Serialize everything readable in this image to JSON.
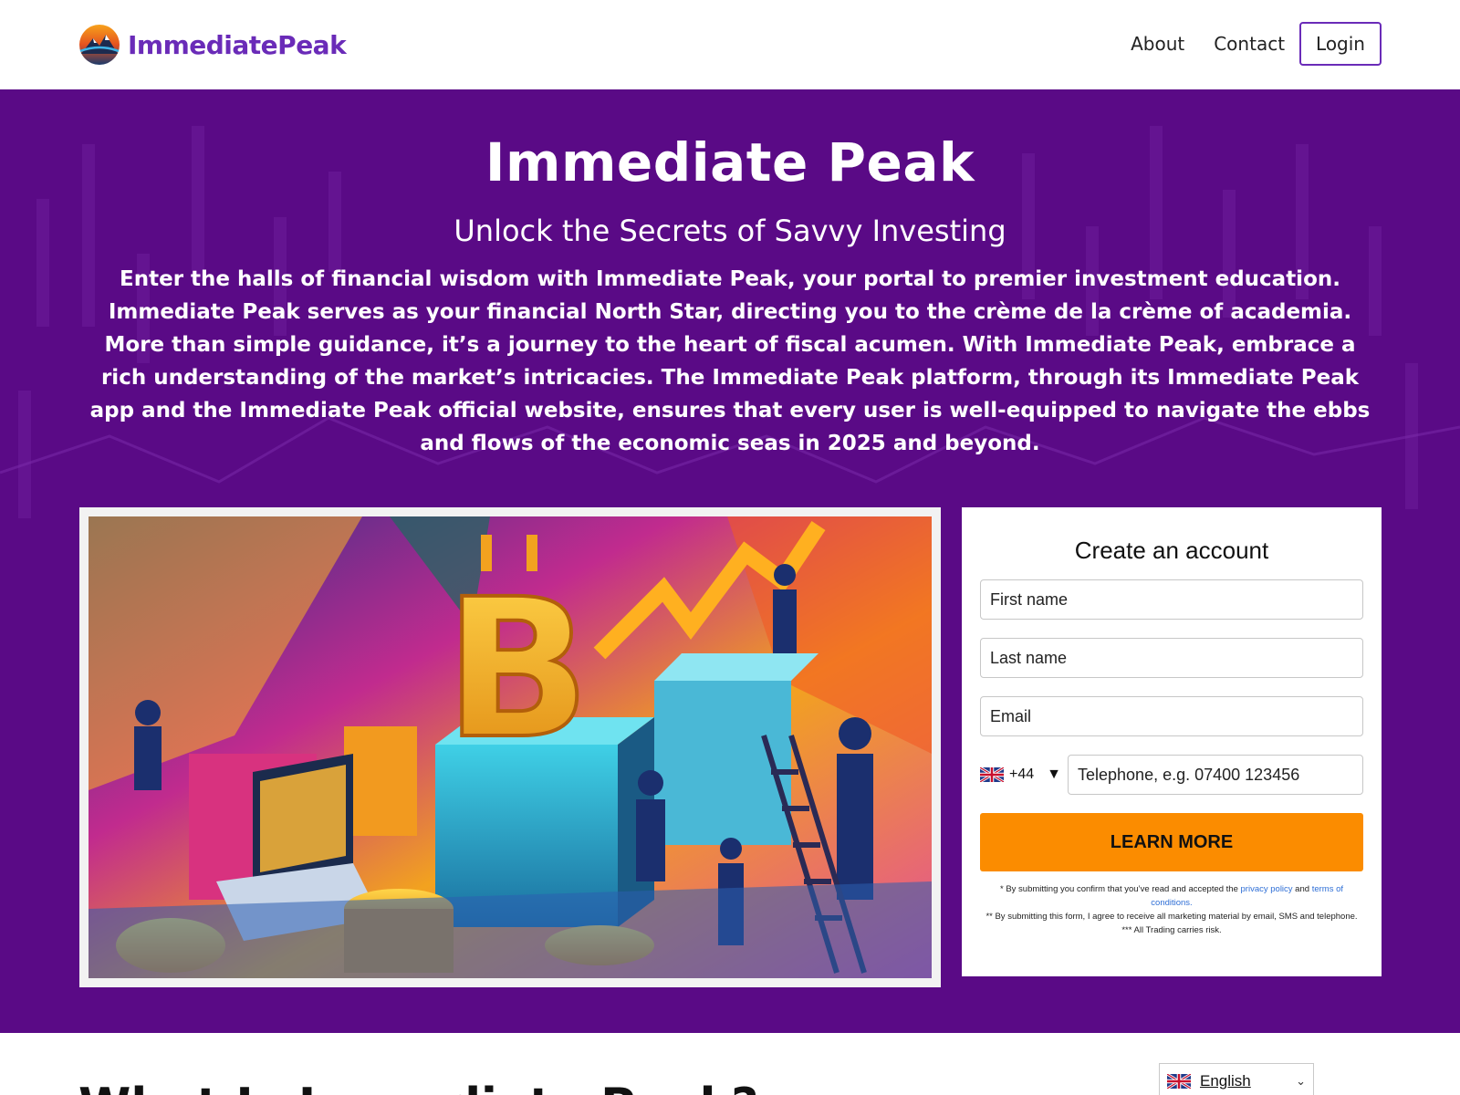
{
  "brand": {
    "name": "ImmediatePeak",
    "logo_icon": "mountain-sun-logo"
  },
  "nav": {
    "about": "About",
    "contact": "Contact",
    "login": "Login"
  },
  "hero": {
    "title": "Immediate Peak",
    "subtitle": "Unlock the Secrets of Savvy Investing",
    "paragraph": "Enter the halls of financial wisdom with Immediate Peak, your portal to premier investment education. Immediate Peak serves as your financial North Star, directing you to the crème de la crème of academia. More than simple guidance, it’s a journey to the heart of fiscal acumen. With Immediate Peak, embrace a rich understanding of the market’s intricacies. The Immediate Peak platform, through its Immediate Peak app and the Immediate Peak official website, ensures that every user is well-equipped to navigate the ebbs and flows of the economic seas in 2025 and beyond.",
    "image_icon": "crypto-investing-illustration"
  },
  "form": {
    "title": "Create an account",
    "first_name_placeholder": "First name",
    "last_name_placeholder": "Last name",
    "email_placeholder": "Email",
    "phone_code": "+44",
    "phone_flag": "uk-flag-icon",
    "phone_placeholder": "Telephone, e.g.  07400 123456",
    "submit_label": "LEARN MORE",
    "disclaimer1_prefix": "* By submitting you confirm that you’ve read and accepted the ",
    "privacy_link": "privacy policy",
    "disclaimer1_and": " and ",
    "terms_link": "terms of conditions.",
    "disclaimer2": "** By submitting this form, I agree to receive all marketing material by email, SMS and telephone.",
    "disclaimer3": "*** All Trading carries risk."
  },
  "section": {
    "title": "What Is Immediate Peak?"
  },
  "language": {
    "selected": "English"
  },
  "colors": {
    "brand_purple": "#6a2bb8",
    "hero_bg": "#5a0a86",
    "cta_orange": "#fb8c00",
    "link_blue": "#2f6fd6"
  }
}
